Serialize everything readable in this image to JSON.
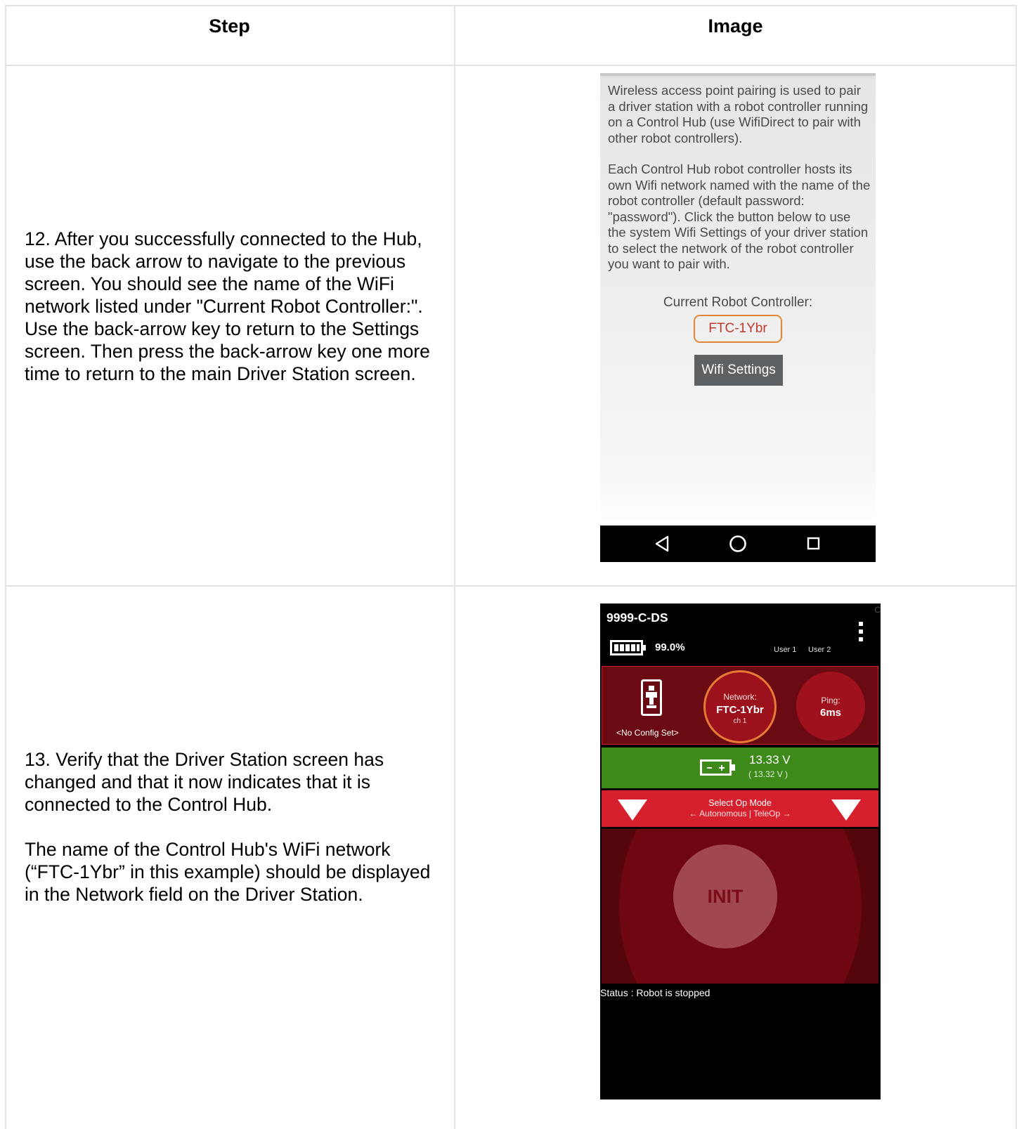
{
  "table": {
    "headers": {
      "step": "Step",
      "image": "Image"
    },
    "rows": [
      {
        "step_text": "12. After you successfully connected to the Hub, use the back arrow to navigate to the previous screen. You should see the name of the WiFi network listed under \"Current Robot Controller:\". Use the back-arrow key to return to the Settings screen. Then press the back-arrow key one more time to return to the main Driver Station screen."
      },
      {
        "step_text": "13. Verify that the Driver Station screen has changed and that it now indicates that it is connected to the Control Hub.",
        "step_text_2": "The name of the Control Hub's WiFi network (“FTC-1Ybr” in this example) should be displayed in the Network field on the Driver Station."
      }
    ]
  },
  "pairing_screen": {
    "paragraph_1": "Wireless access point pairing is used to pair a driver station with a robot controller running on a Control Hub (use WifiDirect to pair with other robot controllers).",
    "paragraph_2": "Each Control Hub robot controller hosts its own Wifi network named with the name of the robot controller (default password: \"password\"). Click the button below to use the system Wifi Settings of your driver station to select the network of the robot controller you want to pair with.",
    "current_label": "Current Robot Controller:",
    "current_value": "FTC-1Ybr",
    "wifi_button": "Wifi Settings",
    "highlight_color": "#e88537",
    "nav_icons": [
      "back-icon",
      "home-icon",
      "recents-icon"
    ]
  },
  "driver_station": {
    "title": "9999-C-DS",
    "corner_mark": "C",
    "battery_percent": "99.0%",
    "user1": "User 1",
    "user2": "User 2",
    "config": "<No Config Set>",
    "network_label": "Network:",
    "network_name": "FTC-1Ybr",
    "network_channel": "ch 1",
    "ping_label": "Ping:",
    "ping_value": "6ms",
    "voltage": "13.33 V",
    "voltage_sub": "( 13.32 V )",
    "opmode_label": "Select Op Mode",
    "opmode_sub": "← Autonomous | TeleOp →",
    "init_label": "INIT",
    "status": "Status : Robot is stopped",
    "colors": {
      "panel": "#6a0a12",
      "network_ring": "#e77a34",
      "voltage_bar": "#3d8a1a",
      "opmode_bar": "#d7202e"
    }
  }
}
